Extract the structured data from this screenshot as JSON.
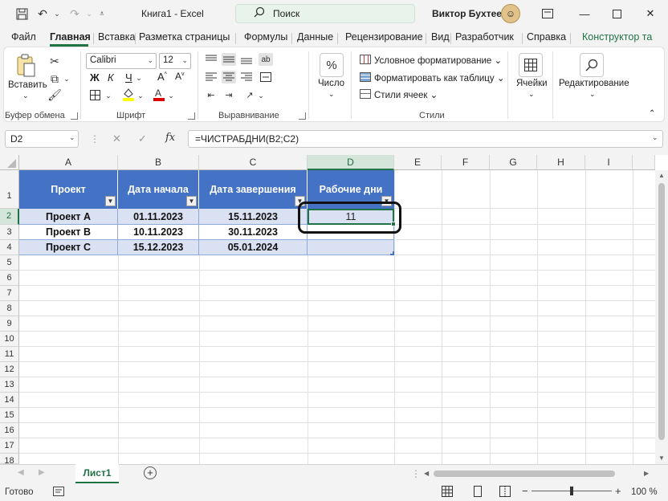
{
  "titlebar": {
    "doc_title": "Книга1 - Excel",
    "search_label": "Поиск",
    "user_name": "Виктор Бухтеев"
  },
  "tabs": [
    "Файл",
    "Главная",
    "Вставка",
    "Разметка страницы",
    "Формулы",
    "Данные",
    "Рецензирование",
    "Вид",
    "Разработчик",
    "Справка",
    "Конструктор та"
  ],
  "ribbon": {
    "clipboard": {
      "paste_label": "Вставить",
      "group_label": "Буфер обмена"
    },
    "font": {
      "font_name": "Calibri",
      "font_size": "12",
      "group_label": "Шрифт",
      "bold": "Ж",
      "italic": "К",
      "underline": "Ч"
    },
    "alignment": {
      "group_label": "Выравнивание"
    },
    "number": {
      "label": "Число",
      "icon": "%"
    },
    "styles": {
      "group_label": "Стили",
      "conditional": "Условное форматирование",
      "as_table": "Форматировать как таблицу",
      "cell_styles": "Стили ячеек"
    },
    "cells": {
      "label": "Ячейки"
    },
    "editing": {
      "label": "Редактирование"
    }
  },
  "formula_bar": {
    "namebox": "D2",
    "fx": "fx",
    "formula": "=ЧИСТРАБДНИ(B2;C2)"
  },
  "grid": {
    "columns": [
      "A",
      "B",
      "C",
      "D",
      "E",
      "F",
      "G",
      "H",
      "I"
    ],
    "rows": [
      "1",
      "2",
      "3",
      "4",
      "5",
      "6",
      "7",
      "8",
      "9",
      "10",
      "11",
      "12",
      "13",
      "14",
      "15",
      "16",
      "17",
      "18"
    ],
    "header_row": [
      "Проект",
      "Дата начала",
      "Дата завершения",
      "Рабочие дни"
    ],
    "data_rows": [
      [
        "Проект A",
        "01.11.2023",
        "15.11.2023",
        "11"
      ],
      [
        "Проект B",
        "10.11.2023",
        "30.11.2023",
        ""
      ],
      [
        "Проект C",
        "15.12.2023",
        "05.01.2024",
        ""
      ]
    ]
  },
  "sheet_tabs": {
    "active": "Лист1"
  },
  "statusbar": {
    "status": "Готово",
    "zoom": "100 %"
  },
  "colors": {
    "accent": "#217346",
    "table_header": "#4472c4",
    "table_band": "#d9e1f2"
  }
}
